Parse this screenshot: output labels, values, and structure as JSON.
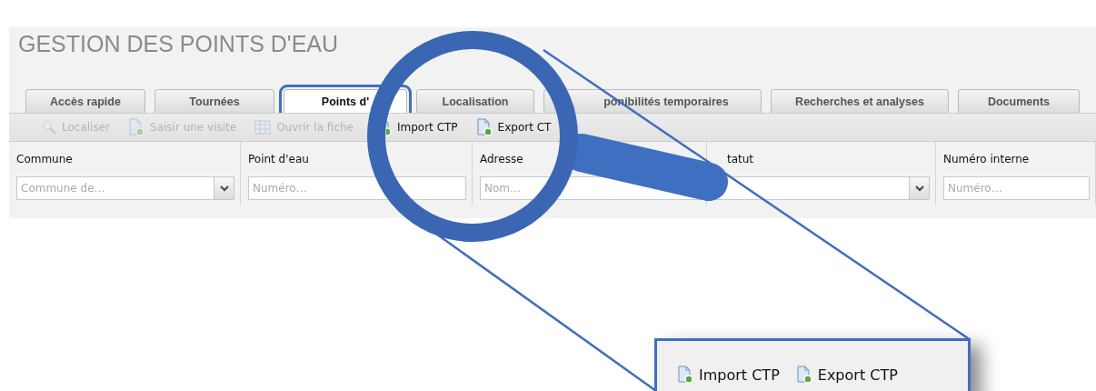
{
  "title": "GESTION DES POINTS D'EAU",
  "tabs": [
    {
      "label": "Accès rapide",
      "selected": false
    },
    {
      "label": "Tournées",
      "selected": false
    },
    {
      "label": "Points d'",
      "selected": true
    },
    {
      "label": "Localisation",
      "selected": false
    },
    {
      "label": "ponibilités temporaires",
      "selected": false
    },
    {
      "label": "Recherches et analyses",
      "selected": false
    },
    {
      "label": "Documents",
      "selected": false
    }
  ],
  "toolbar": [
    {
      "kind": "search",
      "label": "Localiser",
      "disabled": true
    },
    {
      "kind": "document",
      "label": "Saisir une visite",
      "disabled": true
    },
    {
      "kind": "table",
      "label": "Ouvrir la fiche",
      "disabled": true
    },
    {
      "kind": "document-cut",
      "label": "Import CTP",
      "disabled": false
    },
    {
      "kind": "document",
      "label": "Export CT",
      "disabled": false
    }
  ],
  "columns": [
    {
      "header": "Commune",
      "filter": {
        "kind": "dropdown",
        "placeholder": "Commune de…"
      }
    },
    {
      "header": "Point d'eau",
      "filter": {
        "kind": "text",
        "placeholder": "Numéro…"
      }
    },
    {
      "header": "Adresse",
      "filter": {
        "kind": "text",
        "placeholder": "Nom…"
      }
    },
    {
      "header": "tatut",
      "filter": {
        "kind": "dropdown"
      }
    },
    {
      "header": "Numéro interne",
      "filter": {
        "kind": "text",
        "placeholder": "Numéro…"
      }
    }
  ],
  "zoom_inset": {
    "items": [
      {
        "kind": "document",
        "label": "Import CTP"
      },
      {
        "kind": "document",
        "label": "Export CTP"
      }
    ]
  }
}
